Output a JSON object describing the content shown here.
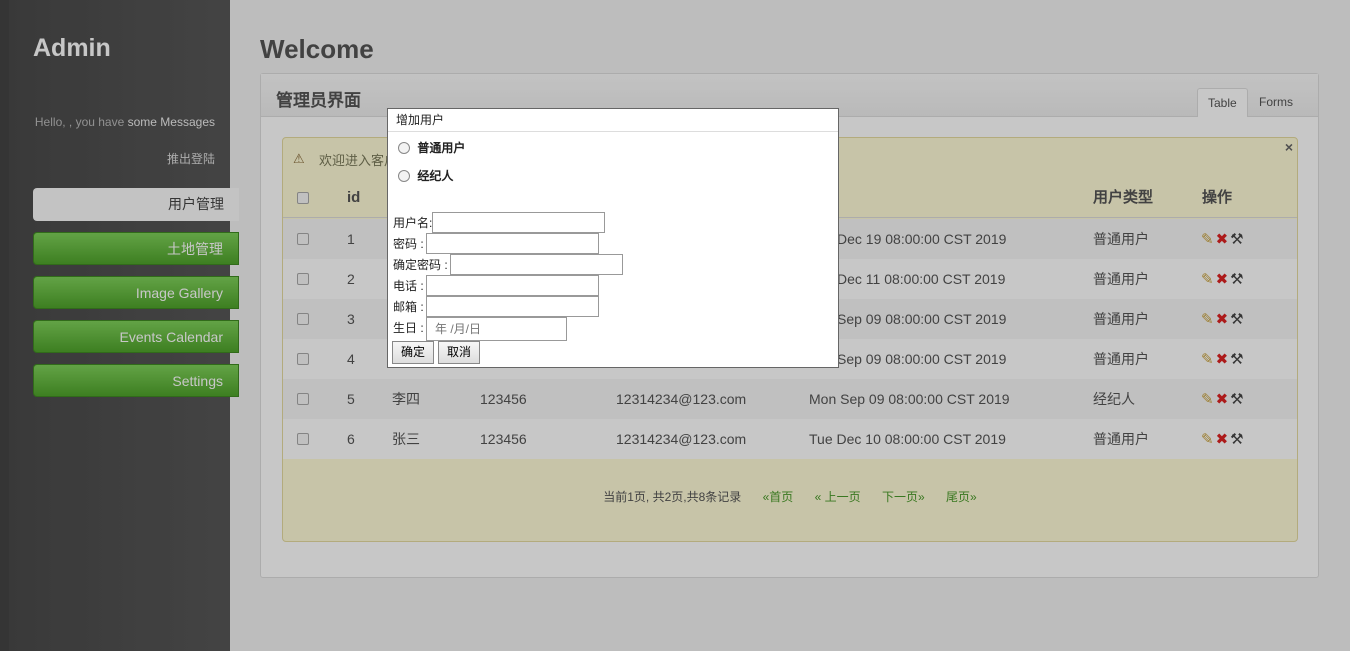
{
  "sidebar": {
    "brand": "Admin",
    "hello_prefix": "Hello, , you have",
    "hello_link": "some Messages",
    "logout": "推出登陆",
    "items": [
      {
        "label": "用户管理"
      },
      {
        "label": "土地管理"
      },
      {
        "label": "Image Gallery"
      },
      {
        "label": "Events Calendar"
      },
      {
        "label": "Settings"
      }
    ]
  },
  "main": {
    "welcome": "Welcome",
    "panel_title": "管理员界面",
    "tabs": [
      {
        "label": "Table"
      },
      {
        "label": "Forms"
      }
    ],
    "notice": "欢迎进入客户",
    "close": "×",
    "table": {
      "headers": {
        "id": "id",
        "type": "用户类型",
        "actions": "操作"
      },
      "rows": [
        {
          "id": "1",
          "name": "",
          "password": "",
          "email": "",
          "birthday": "Dec 19 08:00:00 CST 2019",
          "type": "普通用户"
        },
        {
          "id": "2",
          "name": "",
          "password": "",
          "email": "",
          "birthday": "Dec 11 08:00:00 CST 2019",
          "type": "普通用户"
        },
        {
          "id": "3",
          "name": "",
          "password": "",
          "email": "",
          "birthday": "Sep 09 08:00:00 CST 2019",
          "type": "普通用户"
        },
        {
          "id": "4",
          "name": "",
          "password": "",
          "email": "",
          "birthday": "Sep 09 08:00:00 CST 2019",
          "type": "普通用户"
        },
        {
          "id": "5",
          "name": "李四",
          "password": "123456",
          "email": "12314234@123.com",
          "birthday": "Mon Sep 09 08:00:00 CST 2019",
          "type": "经纪人"
        },
        {
          "id": "6",
          "name": "张三",
          "password": "123456",
          "email": "12314234@123.com",
          "birthday": "Tue Dec 10 08:00:00 CST 2019",
          "type": "普通用户"
        }
      ]
    },
    "pager": {
      "status": "当前1页, 共2页,共8条记录",
      "first": "«首页",
      "prev": "« 上一页",
      "next": "下一页»",
      "last": "尾页»"
    }
  },
  "dialog": {
    "title": "增加用户",
    "radio_normal": "普通用户",
    "radio_agent": "经纪人",
    "username_label": "用户名:",
    "password_label": "密码 :",
    "confirm_label": "确定密码 :",
    "phone_label": "电话 :",
    "email_label": "邮箱 :",
    "birthday_label": "生日 :",
    "birthday_placeholder": "年 /月/日",
    "ok": "确定",
    "cancel": "取消"
  }
}
